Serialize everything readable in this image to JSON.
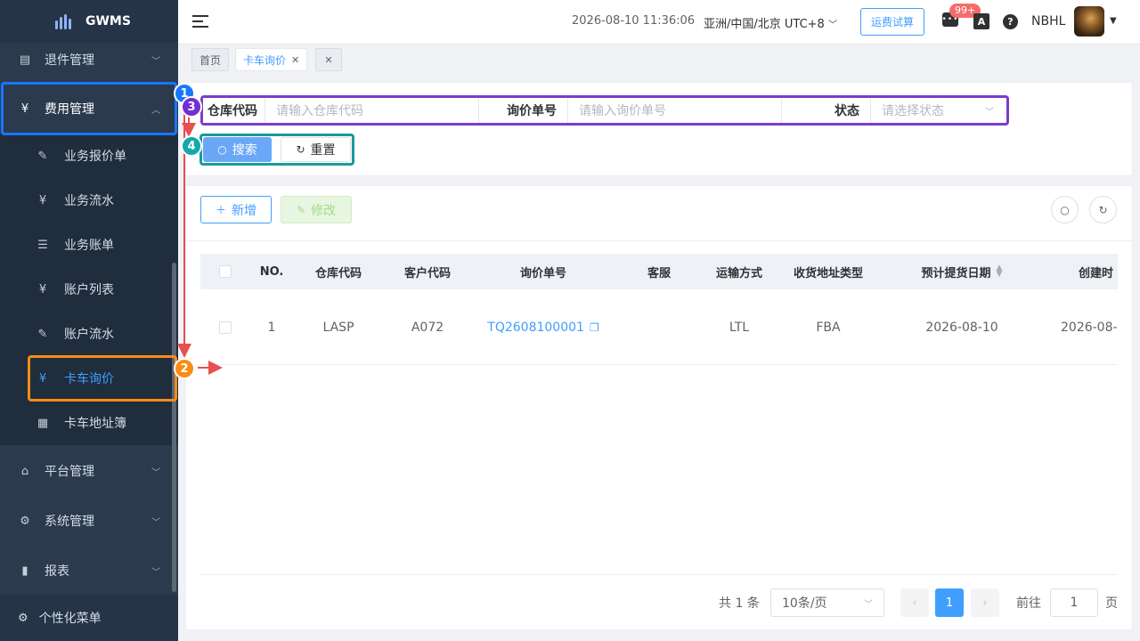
{
  "app": {
    "logo_text": "GWMS"
  },
  "sidebar": {
    "items": [
      {
        "label": "退件管理",
        "icon": "return-icon"
      },
      {
        "label": "费用管理",
        "icon": "yen-icon"
      },
      {
        "label": "业务报价单",
        "icon": "edit-icon"
      },
      {
        "label": "业务流水",
        "icon": "yen-icon"
      },
      {
        "label": "业务账单",
        "icon": "list-icon"
      },
      {
        "label": "账户列表",
        "icon": "yen-icon"
      },
      {
        "label": "账户流水",
        "icon": "edit-icon"
      },
      {
        "label": "卡车询价",
        "icon": "yen-icon"
      },
      {
        "label": "卡车地址簿",
        "icon": "grid-icon"
      },
      {
        "label": "平台管理",
        "icon": "shop-icon"
      },
      {
        "label": "系统管理",
        "icon": "gear-icon"
      },
      {
        "label": "报表",
        "icon": "bar-chart-icon"
      }
    ],
    "personal_label": "个性化菜单"
  },
  "header": {
    "datetime": "2026-08-10 11:36:06",
    "timezone": "亚洲/中国/北京 UTC+8",
    "freight_button": "运费试算",
    "badge": "99+",
    "lang_glyph": "A",
    "help_glyph": "?",
    "user_name": "NBHL"
  },
  "tabs": [
    {
      "label": "首页"
    },
    {
      "label": "卡车询价"
    },
    {
      "label": ""
    }
  ],
  "search": {
    "warehouse_label": "仓库代码",
    "warehouse_placeholder": "请输入仓库代码",
    "inquiry_label": "询价单号",
    "inquiry_placeholder": "请输入询价单号",
    "status_label": "状态",
    "status_placeholder": "请选择状态",
    "search_button": "搜索",
    "reset_button": "重置"
  },
  "toolbar": {
    "add_label": "新增",
    "edit_label": "修改"
  },
  "table": {
    "columns": [
      "NO.",
      "仓库代码",
      "客户代码",
      "询价单号",
      "客服",
      "运输方式",
      "收货地址类型",
      "预计提货日期",
      "创建时"
    ],
    "rows": [
      {
        "no": "1",
        "warehouse": "LASP",
        "customer": "A072",
        "inquiry": "TQ2608100001",
        "service": "",
        "transport": "LTL",
        "address_type": "FBA",
        "pickup_date": "2026-08-10",
        "created": "2026-08-"
      }
    ]
  },
  "pagination": {
    "total": "共 1 条",
    "page_size": "10条/页",
    "current_page": "1",
    "goto_label": "前往",
    "goto_value": "1",
    "page_suffix": "页"
  },
  "annotations": [
    {
      "num": "1",
      "color": "#1677ff"
    },
    {
      "num": "2",
      "color": "#fa8c16"
    },
    {
      "num": "3",
      "color": "#722ed1"
    },
    {
      "num": "4",
      "color": "#13a8a8"
    }
  ],
  "colors": {
    "primary": "#409eff",
    "sidebar_bg": "#2b3a4d",
    "annotation_blue": "#1677ff",
    "annotation_orange": "#fa8c16",
    "annotation_purple": "#7a3ec7",
    "annotation_teal": "#1a9a9a",
    "arrow_red": "#e85050"
  }
}
